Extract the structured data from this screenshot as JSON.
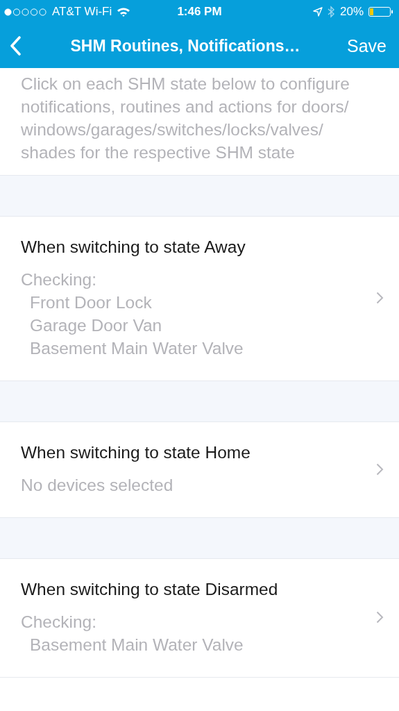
{
  "status_bar": {
    "carrier": "AT&T Wi-Fi",
    "time": "1:46 PM",
    "battery": "20%"
  },
  "nav": {
    "title": "SHM Routines, Notifications…",
    "action": "Save"
  },
  "description": "Click on each SHM state below to configure notifications, routines and actions for doors/windows/garages/switches/locks/valves/shades for the respective SHM state",
  "states": [
    {
      "title": "When switching to state Away",
      "heading": "Checking:",
      "devices": [
        "Front Door Lock",
        "Garage Door Van",
        "Basement Main Water Valve"
      ]
    },
    {
      "title": "When switching to state Home",
      "summary": "No devices selected"
    },
    {
      "title": "When switching to state Disarmed",
      "heading": "Checking:",
      "devices": [
        "Basement Main Water Valve"
      ]
    }
  ]
}
